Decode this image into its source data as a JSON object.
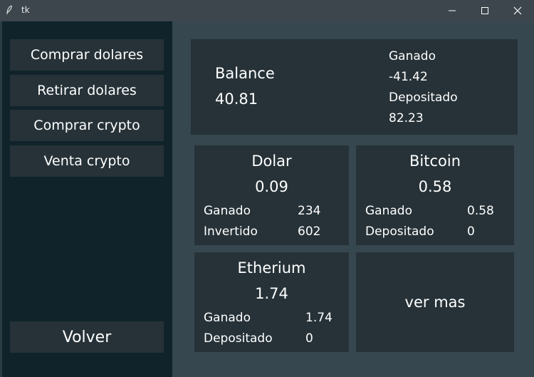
{
  "window": {
    "title": "tk"
  },
  "sidebar": {
    "buy_dollars": "Comprar dolares",
    "withdraw_dollars": "Retirar dolares",
    "buy_crypto": "Comprar crypto",
    "sell_crypto": "Venta crypto",
    "back": "Volver"
  },
  "balance": {
    "label": "Balance",
    "value": "40.81",
    "earned_label": "Ganado",
    "earned_value": "-41.42",
    "deposited_label": "Depositado",
    "deposited_value": "82.23"
  },
  "dolar": {
    "title": "Dolar",
    "value": "0.09",
    "earned_label": "Ganado",
    "earned_value": "234",
    "invested_label": "Invertido",
    "invested_value": "602"
  },
  "bitcoin": {
    "title": "Bitcoin",
    "value": "0.58",
    "earned_label": "Ganado",
    "earned_value": "0.58",
    "deposited_label": "Depositado",
    "deposited_value": "0"
  },
  "etherium": {
    "title": "Etherium",
    "value": "1.74",
    "earned_label": "Ganado",
    "earned_value": "1.74",
    "deposited_label": "Depositado",
    "deposited_value": "0"
  },
  "more": {
    "label": "ver mas"
  },
  "colors": {
    "sidebar_bg": "#11232a",
    "main_bg": "#37474f",
    "card_bg": "#263238",
    "titlebar_bg": "#3d464c"
  }
}
